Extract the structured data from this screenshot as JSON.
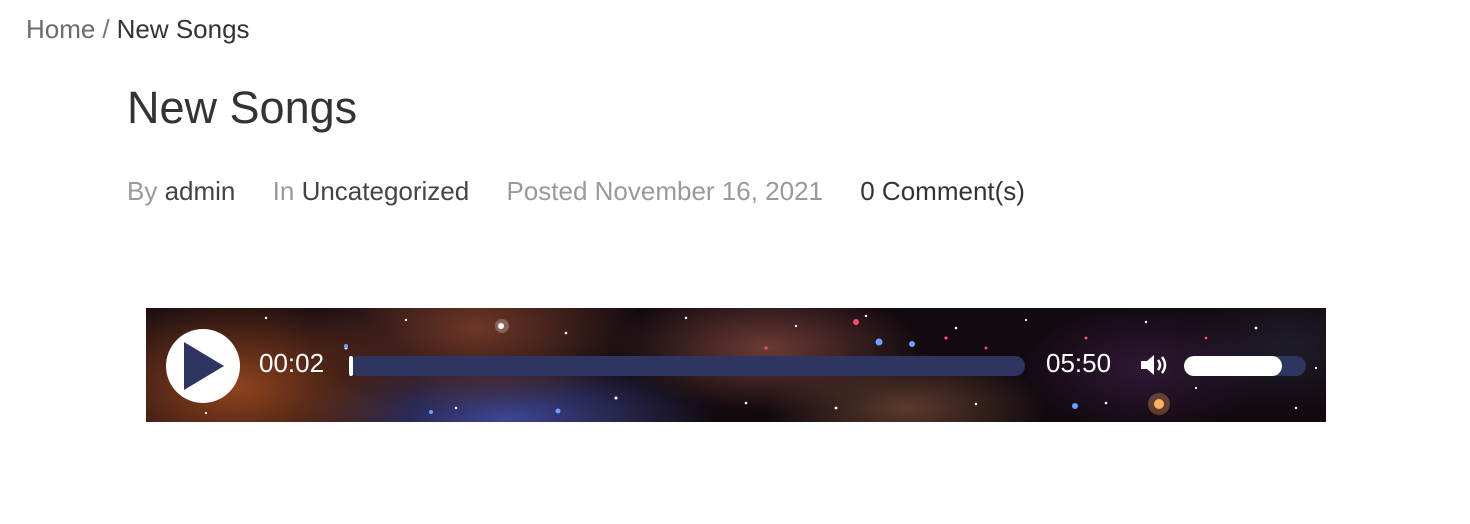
{
  "breadcrumb": {
    "home": "Home",
    "separator": "/",
    "current": "New Songs"
  },
  "post": {
    "title": "New Songs",
    "meta": {
      "by_prefix": "By",
      "author": "admin",
      "in_prefix": "In",
      "category": "Uncategorized",
      "posted_prefix": "Posted",
      "date": "November 16, 2021",
      "comments": "0 Comment(s)"
    }
  },
  "player": {
    "current_time": "00:02",
    "total_time": "05:50",
    "progress_fraction": 0.006,
    "volume_fraction": 0.8,
    "play_icon": "play-icon",
    "volume_icon": "speaker-icon",
    "colors": {
      "bar_track": "#2e3560",
      "bar_fill": "#ffffff",
      "play_triangle": "#2e3560"
    }
  }
}
